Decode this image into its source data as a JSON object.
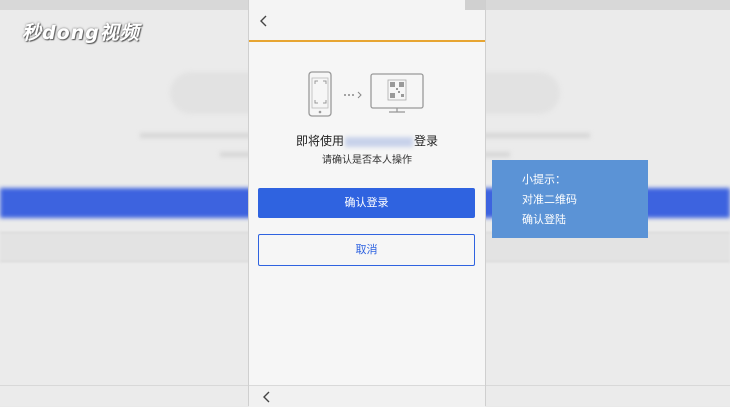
{
  "watermark": {
    "logo_text": "秒dong视频"
  },
  "phone": {
    "title_prefix": "即将使用",
    "title_suffix": "登录",
    "subtitle": "请确认是否本人操作",
    "confirm_button": "确认登录",
    "cancel_button": "取消"
  },
  "tip": {
    "heading": "小提示：",
    "line1": "对准二维码",
    "line2": "确认登陆"
  },
  "colors": {
    "primary_blue": "#2f63e0",
    "header_accent": "#e7a532",
    "tip_background": "#5b93d6"
  }
}
